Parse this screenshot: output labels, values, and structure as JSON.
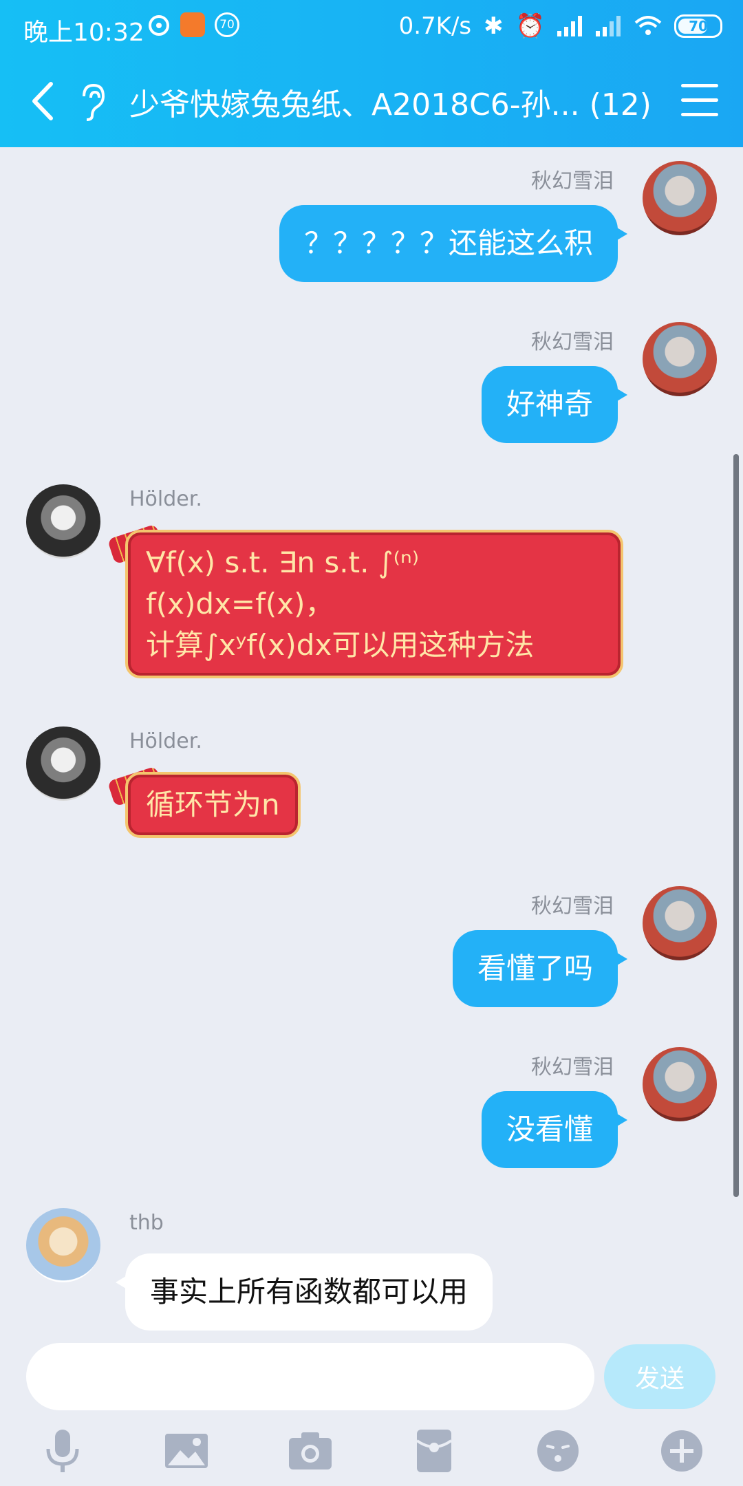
{
  "status_bar": {
    "time": "晚上10:32",
    "notification_badge": "70",
    "net_speed": "0.7K/s",
    "battery": "70"
  },
  "header": {
    "title": "少爷快嫁兔兔纸、A2018C6-孙... (12)"
  },
  "messages": [
    {
      "sender": "秋幻雪泪",
      "side": "right",
      "text": "？？？？？还能这么积"
    },
    {
      "sender": "秋幻雪泪",
      "side": "right",
      "text": "好神奇"
    },
    {
      "sender": "Hölder.",
      "side": "left",
      "lines": [
        "∀f(x)  s.t.  ∃n  s.t.  ∫⁽ⁿ⁾",
        "f(x)dx=f(x)，",
        "计算∫xʸf(x)dx可以用这种方法"
      ]
    },
    {
      "sender": "Hölder.",
      "side": "left",
      "text": "循环节为n"
    },
    {
      "sender": "秋幻雪泪",
      "side": "right",
      "text": "看懂了吗"
    },
    {
      "sender": "秋幻雪泪",
      "side": "right",
      "text": "没看懂"
    },
    {
      "sender": "thb",
      "side": "left",
      "text": "事实上所有函数都可以用"
    }
  ],
  "input": {
    "placeholder": "",
    "send_label": "发送"
  },
  "toolbar": {
    "icons": [
      "microphone-icon",
      "image-icon",
      "camera-icon",
      "red-packet-icon",
      "emoji-icon",
      "plus-icon"
    ]
  },
  "colors": {
    "header_start": "#16bff5",
    "header_end": "#1aa7f3",
    "bubble_self": "#23b1f7",
    "bubble_festive": "#e43445",
    "background": "#eaedf4"
  }
}
